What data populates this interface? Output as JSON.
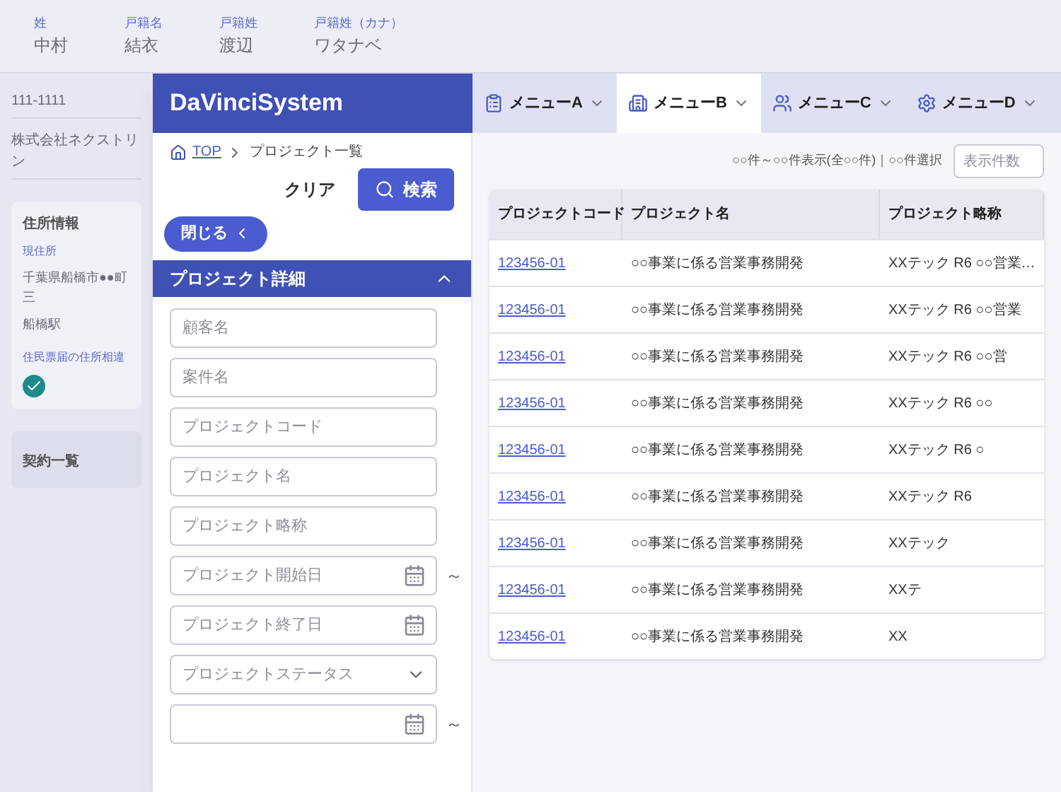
{
  "background_record": {
    "top_fields": [
      {
        "label": "姓",
        "value": "中村"
      },
      {
        "label": "戸籍名",
        "value": "結衣"
      },
      {
        "label": "戸籍姓",
        "value": "渡辺"
      },
      {
        "label": "戸籍姓（カナ）",
        "value": "ワタナベ"
      }
    ],
    "side_values": [
      "111-1111",
      "株式会社ネクストリン"
    ],
    "address_card": {
      "title": "住所情報",
      "label": "現住所",
      "lines": [
        "千葉県船橋市●●町三",
        "船橋駅"
      ],
      "check_label": "住民票届の住所相違",
      "checked": true
    },
    "contracts_title": "契約一覧"
  },
  "app": {
    "logo": "DaVinciSystem",
    "menu": [
      {
        "label": "メニューA",
        "selected": false
      },
      {
        "label": "メニューB",
        "selected": true
      },
      {
        "label": "メニューC",
        "selected": false
      },
      {
        "label": "メニューD",
        "selected": false
      }
    ],
    "breadcrumb": [
      {
        "label": "TOP",
        "kind": "link"
      },
      {
        "label": "プロジェクト一覧",
        "kind": "current"
      }
    ],
    "clear_button": "クリア",
    "search_button": "検索",
    "close_button": "閉じる",
    "section": {
      "title": "プロジェクト詳細",
      "expanded": true
    },
    "fields": [
      {
        "kind": "text",
        "placeholder": "顧客名"
      },
      {
        "kind": "text",
        "placeholder": "案件名"
      },
      {
        "kind": "text",
        "placeholder": "プロジェクトコード"
      },
      {
        "kind": "text",
        "placeholder": "プロジェクト名"
      },
      {
        "kind": "text",
        "placeholder": "プロジェクト略称"
      },
      {
        "kind": "date",
        "placeholder": "プロジェクト開始日",
        "suffix": "～"
      },
      {
        "kind": "date",
        "placeholder": "プロジェクト終了日"
      },
      {
        "kind": "select",
        "placeholder": "プロジェクトステータス"
      },
      {
        "kind": "date",
        "suffix": "～"
      }
    ],
    "summary": "○○件～○○件表示(全○○件)｜○○件選択",
    "page_size": {
      "placeholder": "表示件数"
    },
    "table": {
      "columns": [
        "プロジェクトコード",
        "プロジェクト名",
        "プロジェクト略称"
      ],
      "rows": [
        [
          "123456-01",
          "○○事業に係る営業事務開発",
          "XXテック R6 ○○営業…"
        ],
        [
          "123456-01",
          "○○事業に係る営業事務開発",
          "XXテック R6 ○○営業"
        ],
        [
          "123456-01",
          "○○事業に係る営業事務開発",
          "XXテック R6 ○○営"
        ],
        [
          "123456-01",
          "○○事業に係る営業事務開発",
          "XXテック R6 ○○"
        ],
        [
          "123456-01",
          "○○事業に係る営業事務開発",
          "XXテック R6 ○"
        ],
        [
          "123456-01",
          "○○事業に係る営業事務開発",
          "XXテック R6"
        ],
        [
          "123456-01",
          "○○事業に係る営業事務開発",
          "XXテック"
        ],
        [
          "123456-01",
          "○○事業に係る営業事務開発",
          "XXテ"
        ],
        [
          "123456-01",
          "○○事業に係る営業事務開発",
          "XX"
        ]
      ]
    }
  }
}
